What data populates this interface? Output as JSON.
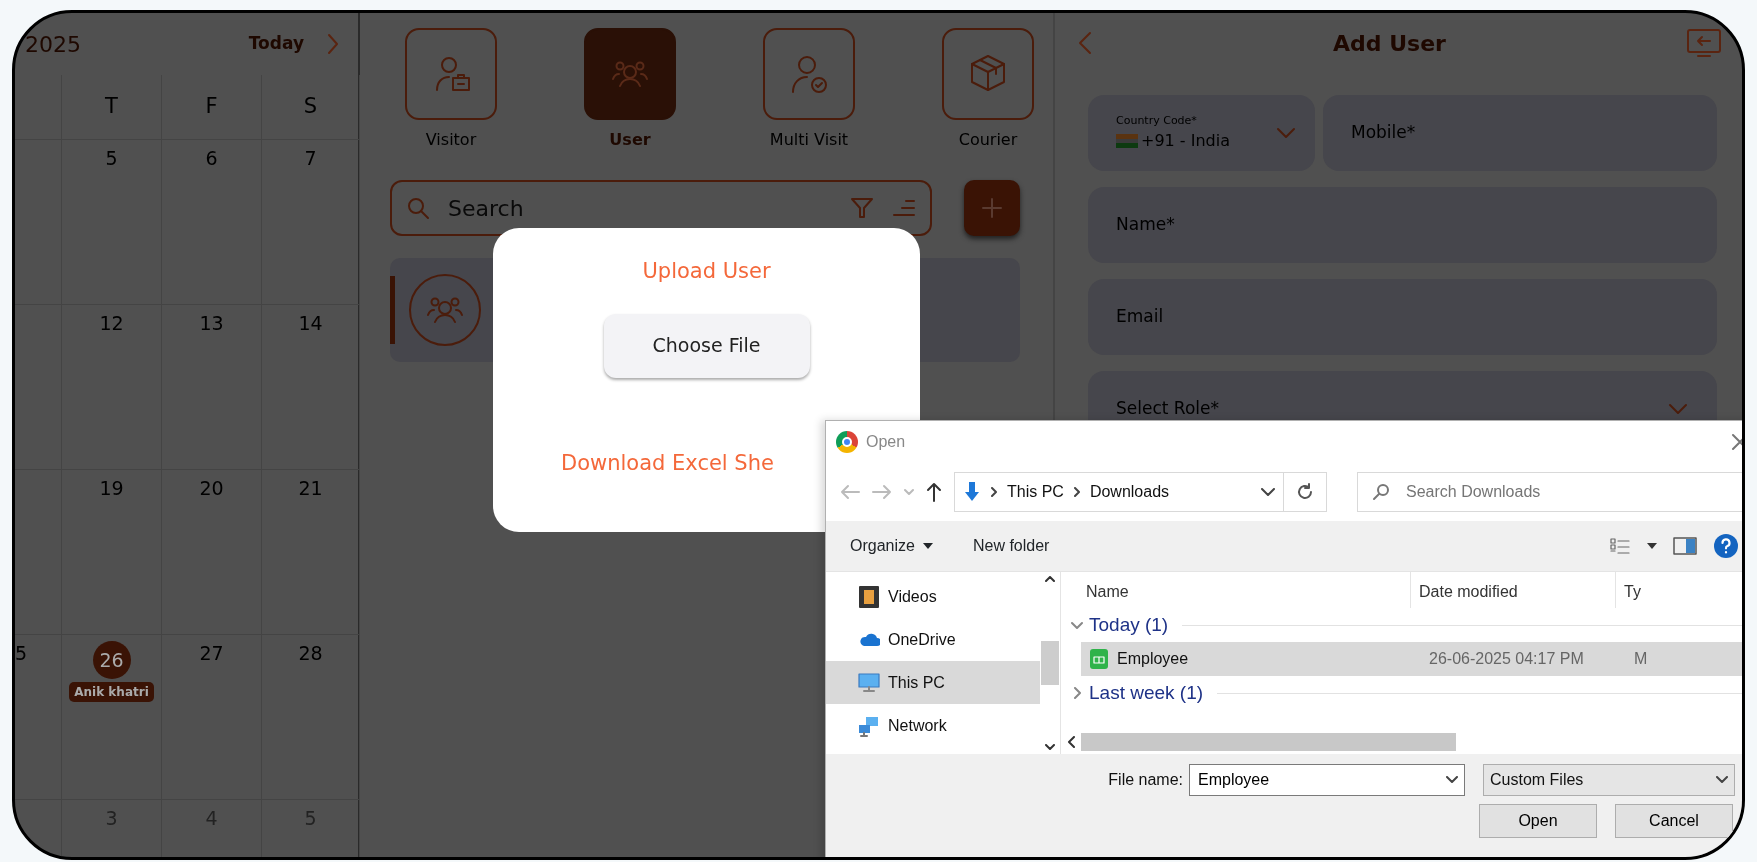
{
  "calendar": {
    "year_label": "2025",
    "today_button": "Today",
    "weekdays": [
      "T",
      "F",
      "S"
    ],
    "weeks": [
      {
        "days": [
          {
            "day": "5",
            "other_month": false,
            "today": false
          },
          {
            "day": "6",
            "other_month": false,
            "today": false
          },
          {
            "day": "7",
            "other_month": false,
            "today": false
          }
        ]
      },
      {
        "days": [
          {
            "day": "12",
            "other_month": false,
            "today": false
          },
          {
            "day": "13",
            "other_month": false,
            "today": false
          },
          {
            "day": "14",
            "other_month": false,
            "today": false
          }
        ]
      },
      {
        "days": [
          {
            "day": "19",
            "other_month": false,
            "today": false
          },
          {
            "day": "20",
            "other_month": false,
            "today": false
          },
          {
            "day": "21",
            "other_month": false,
            "today": false
          }
        ]
      },
      {
        "leading": "5",
        "days": [
          {
            "day": "26",
            "other_month": false,
            "today": true,
            "events": [
              "Anik khatri"
            ]
          },
          {
            "day": "27",
            "other_month": false,
            "today": false
          },
          {
            "day": "28",
            "other_month": false,
            "today": false
          }
        ]
      },
      {
        "days": [
          {
            "day": "3",
            "other_month": true,
            "today": false
          },
          {
            "day": "4",
            "other_month": true,
            "today": false
          },
          {
            "day": "5",
            "other_month": true,
            "today": false
          }
        ]
      }
    ]
  },
  "modules": [
    {
      "label": "Visitor",
      "kind": "visitor",
      "selected": false
    },
    {
      "label": "User",
      "kind": "user",
      "selected": true
    },
    {
      "label": "Multi Visit",
      "kind": "multi",
      "selected": false
    },
    {
      "label": "Courier",
      "kind": "courier",
      "selected": false
    }
  ],
  "search": {
    "placeholder": "Search"
  },
  "upload_modal": {
    "title": "Upload User",
    "choose_button": "Choose File",
    "download_link": "Download Excel She"
  },
  "form": {
    "title": "Add User",
    "country_code": {
      "label": "Country Code*",
      "value": "+91 - India"
    },
    "fields": [
      {
        "placeholder": "Mobile*",
        "kind": "text"
      },
      {
        "placeholder": "Name*",
        "kind": "text"
      },
      {
        "placeholder": "Email",
        "kind": "text"
      },
      {
        "placeholder": "Select Role*",
        "kind": "select"
      }
    ]
  },
  "open_dialog": {
    "title": "Open",
    "path": [
      "This PC",
      "Downloads"
    ],
    "search_placeholder": "Search Downloads",
    "organize": "Organize",
    "new_folder": "New folder",
    "nav_items": [
      {
        "label": "Videos",
        "kind": "videos",
        "selected": false
      },
      {
        "label": "OneDrive",
        "kind": "cloud",
        "selected": false
      },
      {
        "label": "This PC",
        "kind": "pc",
        "selected": true
      },
      {
        "label": "Network",
        "kind": "network",
        "selected": false
      }
    ],
    "columns": [
      "Name",
      "Date modified",
      "Ty"
    ],
    "groups": [
      {
        "label": "Today (1)",
        "expanded": true,
        "files": [
          {
            "name": "Employee",
            "date": "26-06-2025 04:17 PM",
            "type": "M",
            "selected": true
          }
        ]
      },
      {
        "label": "Last week (1)",
        "expanded": false
      }
    ],
    "file_name_label": "File name:",
    "file_name": "Employee",
    "file_type": "Custom Files",
    "buttons": [
      "Open",
      "Cancel"
    ]
  }
}
